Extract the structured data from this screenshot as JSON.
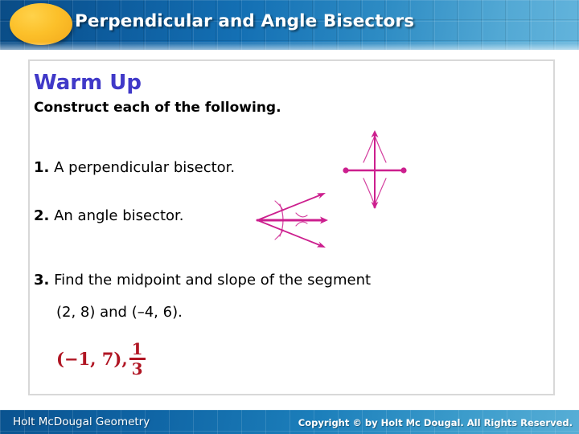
{
  "header": {
    "title": "Perpendicular and Angle Bisectors",
    "badge_icon": "yellow-ellipse-icon",
    "gradient_start": "#0a4c86",
    "gradient_end": "#63b4dc",
    "badge_color": "#fcc02a"
  },
  "content": {
    "warmup_title": "Warm Up",
    "warmup_title_color": "#4039c8",
    "instruction": "Construct each of the following.",
    "items": [
      {
        "number": "1.",
        "text": "A perpendicular bisector."
      },
      {
        "number": "2.",
        "text": "An angle bisector."
      },
      {
        "number": "3.",
        "text": "Find the midpoint and slope of the segment"
      }
    ],
    "item3_second_line": "(2, 8) and (–4, 6).",
    "answer": {
      "pair": "(−1, 7),",
      "fraction_numerator": "1",
      "fraction_denominator": "3",
      "color": "#b01523"
    }
  },
  "diagrams": {
    "perpendicular_bisector": {
      "name": "perpendicular-bisector-construction",
      "color": "#cc1f8e",
      "description": "Horizontal segment with two endpoints crossed by a vertical double-arrow bisector line with construction arcs"
    },
    "angle_bisector": {
      "name": "angle-bisector-construction",
      "color": "#cc1f8e",
      "description": "Vertex at left with two rays forming an angle and a bold horizontal bisector ray with construction arcs"
    }
  },
  "footer": {
    "left_text": "Holt McDougal Geometry",
    "right_text": "Copyright © by Holt Mc Dougal. All Rights Reserved."
  }
}
